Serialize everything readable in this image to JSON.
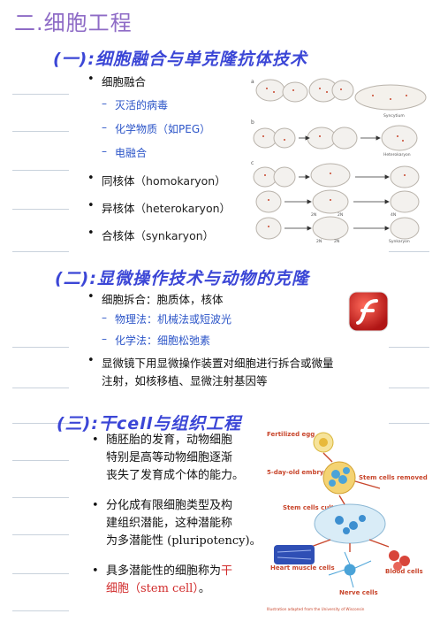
{
  "page": {
    "title": "二.细胞工程"
  },
  "section1": {
    "title": "(一):细胞融合与单克隆抗体技术",
    "bullets": [
      {
        "label": "细胞融合",
        "subitems": [
          "灭活的病毒",
          "化学物质（如PEG）",
          "电融合"
        ]
      },
      {
        "label": "同核体",
        "paren": "（homokaryon）"
      },
      {
        "label": "异核体",
        "paren": "（heterokaryon）"
      },
      {
        "label": "合核体",
        "paren": "（synkaryon）"
      }
    ],
    "figure": {
      "row_labels": [
        "a",
        "b",
        "c"
      ],
      "captions": [
        "Syncytium",
        "Heterokaryon",
        "Synkaryon"
      ],
      "small_labels": [
        "2N",
        "2N",
        "4N",
        "2N",
        "2N"
      ]
    }
  },
  "section2": {
    "title": "(二):显微操作技术与动物的克隆",
    "bullets": [
      {
        "label": "细胞拆合：胞质体，核体",
        "subitems": [
          "物理法：机械法或短波光",
          "化学法：细胞松弛素"
        ]
      },
      {
        "label_lines": [
          "显微镜下用显微操作装置对细胞进行拆合或微量",
          "注射，如核移植、显微注射基因等"
        ]
      }
    ]
  },
  "section3": {
    "title": "(三):干cell与组织工程",
    "paragraphs": [
      {
        "lines": [
          "随胚胎的发育，动物细胞",
          "特别是高等动物细胞逐渐",
          "丧失了发育成个体的能力。"
        ]
      },
      {
        "lines": [
          "分化成有限细胞类型及构",
          "建组织潜能，这种潜能称",
          "为多潜能性 (pluripotency)。"
        ]
      },
      {
        "lines_before": "具多潜能性的细胞称为",
        "red1": "干",
        "red2": "细胞（stem cell）",
        "after": "。"
      }
    ],
    "figure": {
      "labels": [
        "Fertilized egg",
        "5-day-old embryo",
        "Stem cells removed",
        "Stem cells cultured",
        "Heart muscle cells",
        "Blood cells",
        "Nerve cells"
      ],
      "credit": "Illustration adapted from the University of Wisconsin"
    }
  },
  "colors": {
    "title_purple": "#8e6bc6",
    "heading_blue": "#3b46d6",
    "sub_blue": "#2c55c8",
    "accent_red": "#d12b2b",
    "figure_red": "#c8462c",
    "flash_red": "#c81e1e"
  },
  "icons": [
    "flash-player-icon"
  ]
}
